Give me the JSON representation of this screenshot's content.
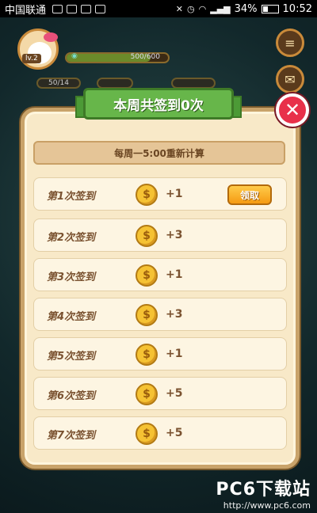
{
  "status_bar": {
    "carrier": "中国联通",
    "battery": "34%",
    "time": "10:52"
  },
  "background": {
    "level_badge": "lv.2",
    "xp_text": "500/600",
    "xp_progress": 0.83,
    "stats": [
      "50/14",
      "",
      ""
    ]
  },
  "dialog": {
    "title": "本周共签到0次",
    "reset_note": "每周一5:00重新计算",
    "close_symbol": "✕",
    "rows": [
      {
        "label": "第1次签到",
        "reward": "+1",
        "claim": "领取"
      },
      {
        "label": "第2次签到",
        "reward": "+3"
      },
      {
        "label": "第3次签到",
        "reward": "+1"
      },
      {
        "label": "第4次签到",
        "reward": "+3"
      },
      {
        "label": "第5次签到",
        "reward": "+1"
      },
      {
        "label": "第6次签到",
        "reward": "+5"
      },
      {
        "label": "第7次签到",
        "reward": "+5"
      }
    ]
  },
  "watermark": {
    "logo": "PC6下载站",
    "url": "http://www.pc6.com"
  },
  "icons": {
    "coin": "$",
    "menu": "≡",
    "mail": "✉"
  },
  "colors": {
    "ribbon": "#67b64a",
    "close": "#e8304a",
    "coin": "#f5c233",
    "claim": "#f59a12"
  }
}
